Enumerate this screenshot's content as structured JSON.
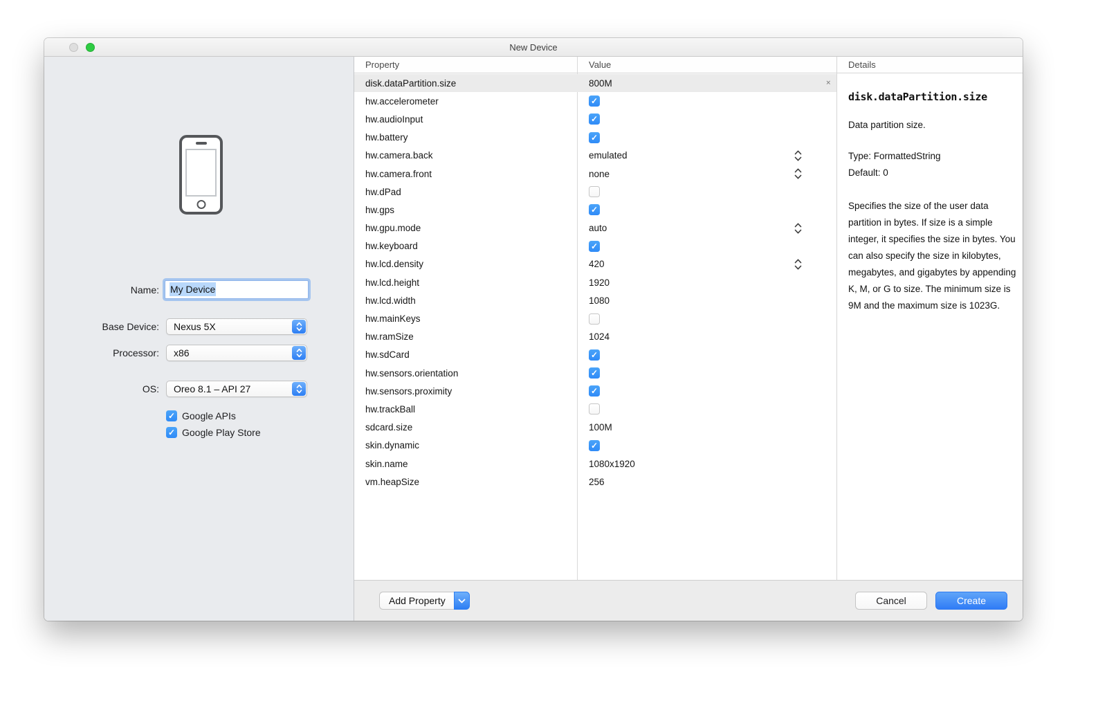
{
  "window": {
    "title": "New Device"
  },
  "left_panel": {
    "name_label": "Name:",
    "name_value": "My Device",
    "base_device_label": "Base Device:",
    "base_device_value": "Nexus 5X",
    "processor_label": "Processor:",
    "processor_value": "x86",
    "os_label": "OS:",
    "os_value": "Oreo 8.1 – API 27",
    "checkboxes": [
      {
        "label": "Google APIs",
        "checked": true
      },
      {
        "label": "Google Play Store",
        "checked": true
      }
    ]
  },
  "table": {
    "columns": {
      "property": "Property",
      "value": "Value",
      "details": "Details"
    },
    "rows": [
      {
        "property": "disk.dataPartition.size",
        "type": "text",
        "value": "800M",
        "selected": true,
        "removable": true
      },
      {
        "property": "hw.accelerometer",
        "type": "checkbox",
        "checked": true
      },
      {
        "property": "hw.audioInput",
        "type": "checkbox",
        "checked": true
      },
      {
        "property": "hw.battery",
        "type": "checkbox",
        "checked": true
      },
      {
        "property": "hw.camera.back",
        "type": "select",
        "value": "emulated"
      },
      {
        "property": "hw.camera.front",
        "type": "select",
        "value": "none"
      },
      {
        "property": "hw.dPad",
        "type": "checkbox",
        "checked": false
      },
      {
        "property": "hw.gps",
        "type": "checkbox",
        "checked": true
      },
      {
        "property": "hw.gpu.mode",
        "type": "select",
        "value": "auto"
      },
      {
        "property": "hw.keyboard",
        "type": "checkbox",
        "checked": true
      },
      {
        "property": "hw.lcd.density",
        "type": "select",
        "value": "420"
      },
      {
        "property": "hw.lcd.height",
        "type": "text",
        "value": "1920"
      },
      {
        "property": "hw.lcd.width",
        "type": "text",
        "value": "1080"
      },
      {
        "property": "hw.mainKeys",
        "type": "checkbox",
        "checked": false
      },
      {
        "property": "hw.ramSize",
        "type": "text",
        "value": "1024"
      },
      {
        "property": "hw.sdCard",
        "type": "checkbox",
        "checked": true
      },
      {
        "property": "hw.sensors.orientation",
        "type": "checkbox",
        "checked": true
      },
      {
        "property": "hw.sensors.proximity",
        "type": "checkbox",
        "checked": true
      },
      {
        "property": "hw.trackBall",
        "type": "checkbox",
        "checked": false
      },
      {
        "property": "sdcard.size",
        "type": "text",
        "value": "100M"
      },
      {
        "property": "skin.dynamic",
        "type": "checkbox",
        "checked": true
      },
      {
        "property": "skin.name",
        "type": "text",
        "value": "1080x1920"
      },
      {
        "property": "vm.heapSize",
        "type": "text",
        "value": "256"
      }
    ]
  },
  "details": {
    "header": "Details",
    "title": "disk.dataPartition.size",
    "summary": "Data partition size.",
    "type_line": "Type: FormattedString",
    "default_line": "Default: 0",
    "description": "Specifies the size of the user data partition in bytes. If size is a simple integer, it specifies the size in bytes. You can also specify the size in kilobytes, megabytes, and gigabytes by appending K, M, or G to size. The minimum size is 9M and the maximum size is 1023G."
  },
  "footer": {
    "add_property_label": "Add Property",
    "cancel_label": "Cancel",
    "create_label": "Create"
  },
  "icons": {
    "stepper": "up-down-chevrons",
    "popup_cap": "up-down-chevrons-white",
    "add_property_cap": "chevron-down-white",
    "remove": "small-x",
    "checkbox_check": "checkmark"
  },
  "colors": {
    "accent_blue": "#3b84f7",
    "checkbox_blue": "#3f9af9",
    "selection_blue": "#b9d8fb",
    "selected_row": "#ebebeb",
    "left_panel_bg": "#e9ebee"
  }
}
